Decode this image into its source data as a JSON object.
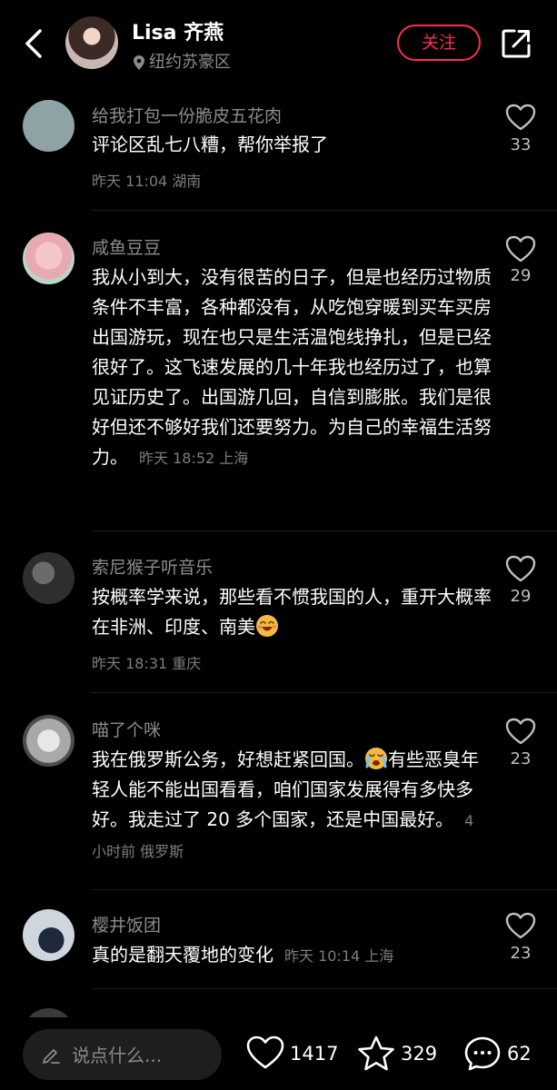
{
  "header": {
    "user_name": "Lisa 齐燕",
    "location": "纽约苏豪区",
    "follow_label": "关注"
  },
  "comments": [
    {
      "name": "给我打包一份脆皮五花肉",
      "text": "评论区乱七八糟，帮你举报了",
      "meta": "昨天 11:04 湖南",
      "likes": "33"
    },
    {
      "name": "咸鱼豆豆",
      "text": "我从小到大，没有很苦的日子，但是也经历过物质条件不丰富，各种都没有，从吃饱穿暖到买车买房出国游玩，现在也只是生活温饱线挣扎，但是已经很好了。这飞速发展的几十年我也经历过了，也算见证历史了。出国游几回，自信到膨胀。我们是很好但还不够好我们还要努力。为自己的幸福生活努力。",
      "meta": "昨天 18:52 上海",
      "likes": "29"
    },
    {
      "name": "索尼猴子听音乐",
      "text": "按概率学来说，那些看不惯我国的人，重开大概率在非洲、印度、南美",
      "meta": "昨天 18:31 重庆",
      "likes": "29"
    },
    {
      "name": "喵了个咪",
      "text_a": "我在俄罗斯公务，好想赶紧回国。",
      "text_b": "有些恶臭年轻人能不能出国看看，咱们国家发展得有多快多好。我走过了 20 多个国家，还是中国最好。",
      "meta": "4 小时前 俄罗斯",
      "likes": "23"
    },
    {
      "name": "樱井饭团",
      "text": "真的是翻天覆地的变化",
      "meta": "昨天 10:14 上海",
      "likes": "23"
    }
  ],
  "bottom_bar": {
    "input_placeholder": "说点什么...",
    "likes": "1417",
    "favorites": "329",
    "comments": "62"
  }
}
